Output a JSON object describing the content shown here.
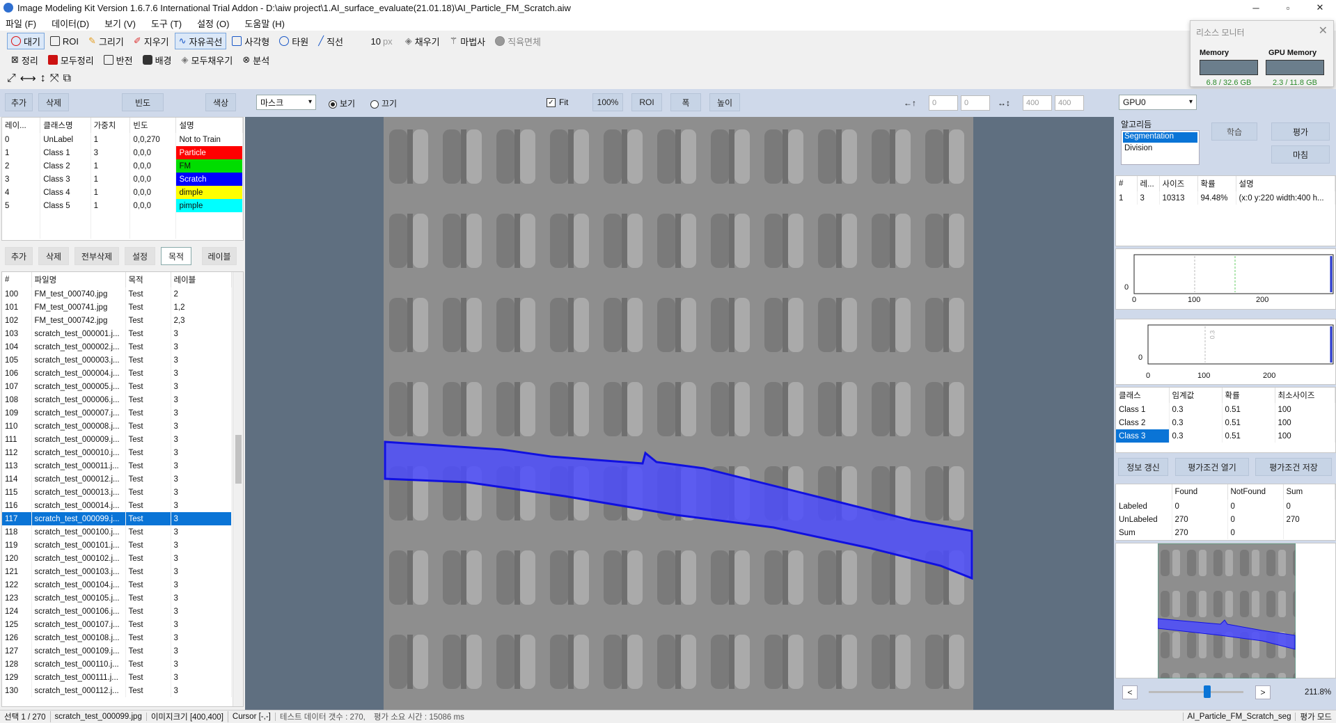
{
  "window": {
    "title": "Image Modeling Kit   Version 1.6.7.6  International Trial Addon    - D:\\aiw project\\1.AI_surface_evaluate(21.01.18)\\AI_Particle_FM_Scratch.aiw",
    "minimize": "─",
    "maximize": "▫",
    "close": "✕"
  },
  "menu": [
    "파일 (F)",
    "데이터(D)",
    "보기 (V)",
    "도구 (T)",
    "설정 (O)",
    "도움말 (H)"
  ],
  "toolbar1": {
    "wait": "대기",
    "roi": "ROI",
    "draw": "그리기",
    "erase": "지우기",
    "freecurve": "자유곡선",
    "rect": "사각형",
    "ellipse": "타원",
    "line": "직선",
    "brush_size": "10",
    "brush_unit": "px",
    "fill": "채우기",
    "wand": "마법사",
    "right_area": "직육면체"
  },
  "toolbar2": {
    "clean": "정리",
    "clean_all": "모두정리",
    "invert": "반전",
    "background": "배경",
    "fill_all": "모두채우기",
    "analyze": "분석"
  },
  "resource_monitor": {
    "title": "리소스 모니터",
    "close": "✕",
    "memory_label": "Memory",
    "memory_value": "6.8 / 32.6 GB",
    "gpu_label": "GPU Memory",
    "gpu_value": "2.3 / 11.8 GB"
  },
  "class_buttons": {
    "add": "추가",
    "delete": "삭제",
    "frequency": "빈도",
    "color": "색상"
  },
  "class_table": {
    "headers": [
      "레이...",
      "클래스명",
      "가중치",
      "빈도",
      "설명"
    ],
    "rows": [
      {
        "id": "0",
        "name": "UnLabel",
        "weight": "1",
        "freq": "0,0,270",
        "desc": "Not to Train",
        "color": "#ffffff"
      },
      {
        "id": "1",
        "name": "Class 1",
        "weight": "3",
        "freq": "0,0,0",
        "desc": "Particle",
        "color": "#ff0000"
      },
      {
        "id": "2",
        "name": "Class 2",
        "weight": "1",
        "freq": "0,0,0",
        "desc": "FM",
        "color": "#00dd00"
      },
      {
        "id": "3",
        "name": "Class 3",
        "weight": "1",
        "freq": "0,0,0",
        "desc": "Scratch",
        "color": "#0000ff"
      },
      {
        "id": "4",
        "name": "Class 4",
        "weight": "1",
        "freq": "0,0,0",
        "desc": "dimple",
        "color": "#ffff00"
      },
      {
        "id": "5",
        "name": "Class 5",
        "weight": "1",
        "freq": "0,0,0",
        "desc": "pimple",
        "color": "#00ffff"
      }
    ]
  },
  "file_buttons": {
    "add": "추가",
    "delete": "삭제",
    "delete_all": "전부삭제",
    "settings": "설정",
    "purpose": "목적",
    "label": "레이블"
  },
  "file_table": {
    "headers": [
      "#",
      "파일명",
      "목적",
      "레이블"
    ],
    "rows": [
      {
        "n": "100",
        "file": "FM_test_000740.jpg",
        "purpose": "Test",
        "label": "2"
      },
      {
        "n": "101",
        "file": "FM_test_000741.jpg",
        "purpose": "Test",
        "label": "1,2"
      },
      {
        "n": "102",
        "file": "FM_test_000742.jpg",
        "purpose": "Test",
        "label": "2,3"
      },
      {
        "n": "103",
        "file": "scratch_test_000001.j...",
        "purpose": "Test",
        "label": "3"
      },
      {
        "n": "104",
        "file": "scratch_test_000002.j...",
        "purpose": "Test",
        "label": "3"
      },
      {
        "n": "105",
        "file": "scratch_test_000003.j...",
        "purpose": "Test",
        "label": "3"
      },
      {
        "n": "106",
        "file": "scratch_test_000004.j...",
        "purpose": "Test",
        "label": "3"
      },
      {
        "n": "107",
        "file": "scratch_test_000005.j...",
        "purpose": "Test",
        "label": "3"
      },
      {
        "n": "108",
        "file": "scratch_test_000006.j...",
        "purpose": "Test",
        "label": "3"
      },
      {
        "n": "109",
        "file": "scratch_test_000007.j...",
        "purpose": "Test",
        "label": "3"
      },
      {
        "n": "110",
        "file": "scratch_test_000008.j...",
        "purpose": "Test",
        "label": "3"
      },
      {
        "n": "111",
        "file": "scratch_test_000009.j...",
        "purpose": "Test",
        "label": "3"
      },
      {
        "n": "112",
        "file": "scratch_test_000010.j...",
        "purpose": "Test",
        "label": "3"
      },
      {
        "n": "113",
        "file": "scratch_test_000011.j...",
        "purpose": "Test",
        "label": "3"
      },
      {
        "n": "114",
        "file": "scratch_test_000012.j...",
        "purpose": "Test",
        "label": "3"
      },
      {
        "n": "115",
        "file": "scratch_test_000013.j...",
        "purpose": "Test",
        "label": "3"
      },
      {
        "n": "116",
        "file": "scratch_test_000014.j...",
        "purpose": "Test",
        "label": "3"
      },
      {
        "n": "117",
        "file": "scratch_test_000099.j...",
        "purpose": "Test",
        "label": "3",
        "selected": true
      },
      {
        "n": "118",
        "file": "scratch_test_000100.j...",
        "purpose": "Test",
        "label": "3"
      },
      {
        "n": "119",
        "file": "scratch_test_000101.j...",
        "purpose": "Test",
        "label": "3"
      },
      {
        "n": "120",
        "file": "scratch_test_000102.j...",
        "purpose": "Test",
        "label": "3"
      },
      {
        "n": "121",
        "file": "scratch_test_000103.j...",
        "purpose": "Test",
        "label": "3"
      },
      {
        "n": "122",
        "file": "scratch_test_000104.j...",
        "purpose": "Test",
        "label": "3"
      },
      {
        "n": "123",
        "file": "scratch_test_000105.j...",
        "purpose": "Test",
        "label": "3"
      },
      {
        "n": "124",
        "file": "scratch_test_000106.j...",
        "purpose": "Test",
        "label": "3"
      },
      {
        "n": "125",
        "file": "scratch_test_000107.j...",
        "purpose": "Test",
        "label": "3"
      },
      {
        "n": "126",
        "file": "scratch_test_000108.j...",
        "purpose": "Test",
        "label": "3"
      },
      {
        "n": "127",
        "file": "scratch_test_000109.j...",
        "purpose": "Test",
        "label": "3"
      },
      {
        "n": "128",
        "file": "scratch_test_000110.j...",
        "purpose": "Test",
        "label": "3"
      },
      {
        "n": "129",
        "file": "scratch_test_000111.j...",
        "purpose": "Test",
        "label": "3"
      },
      {
        "n": "130",
        "file": "scratch_test_000112.j...",
        "purpose": "Test",
        "label": "3"
      }
    ]
  },
  "viewbar": {
    "mode_select": "마스크",
    "view": "보기",
    "off": "끄기",
    "fit": "Fit",
    "zoom100": "100%",
    "roi": "ROI",
    "width": "폭",
    "height": "높이",
    "x": "0",
    "y": "0",
    "w": "400",
    "h": "400",
    "arrow1": "←↑",
    "arrow2": "↔↕"
  },
  "right": {
    "gpu_select": "GPU0",
    "algo_label": "알고리듬",
    "algorithms": [
      "Segmentation",
      "Division"
    ],
    "train": "학습",
    "evaluate": "평가",
    "finish": "마침",
    "result_headers": [
      "#",
      "레...",
      "사이즈",
      "확률",
      "설명"
    ],
    "result_row": [
      "1",
      "3",
      "10313",
      "94.48%",
      "(x:0 y:220 width:400 h..."
    ],
    "hist1_ticks": [
      "0",
      "100",
      "200"
    ],
    "hist1_zero": "0",
    "hist2_ticks": [
      "0",
      "100",
      "200"
    ],
    "hist2_zero": "0",
    "hist2_label": "0.3",
    "thresh_headers": [
      "클래스",
      "임계값",
      "확률",
      "최소사이즈"
    ],
    "thresh_rows": [
      [
        "Class 1",
        "0.3",
        "0.51",
        "100"
      ],
      [
        "Class 2",
        "0.3",
        "0.51",
        "100"
      ],
      [
        "Class 3",
        "0.3",
        "0.51",
        "100"
      ]
    ],
    "btn_refresh": "정보 갱신",
    "btn_open": "평가조건 열기",
    "btn_save": "평가조건 저장",
    "eval_headers": [
      "",
      "Found",
      "NotFound",
      "Sum"
    ],
    "eval_rows": [
      [
        "Labeled",
        "0",
        "0",
        "0"
      ],
      [
        "UnLabeled",
        "270",
        "0",
        "270"
      ],
      [
        "Sum",
        "270",
        "0",
        ""
      ]
    ],
    "zoom": "211.8%",
    "prev": "<",
    "next": ">"
  },
  "status": {
    "selection": "선택 1 / 270",
    "file": "scratch_test_000099.jpg",
    "size": "이미지크기 [400,400]",
    "cursor": "Cursor [-,-]",
    "test_count": "테스트 데이터 갯수 : 270,",
    "time": "평가 소요 시간 : 15086 ms",
    "model": "AI_Particle_FM_Scratch_seg",
    "mode": "평가 모드"
  }
}
